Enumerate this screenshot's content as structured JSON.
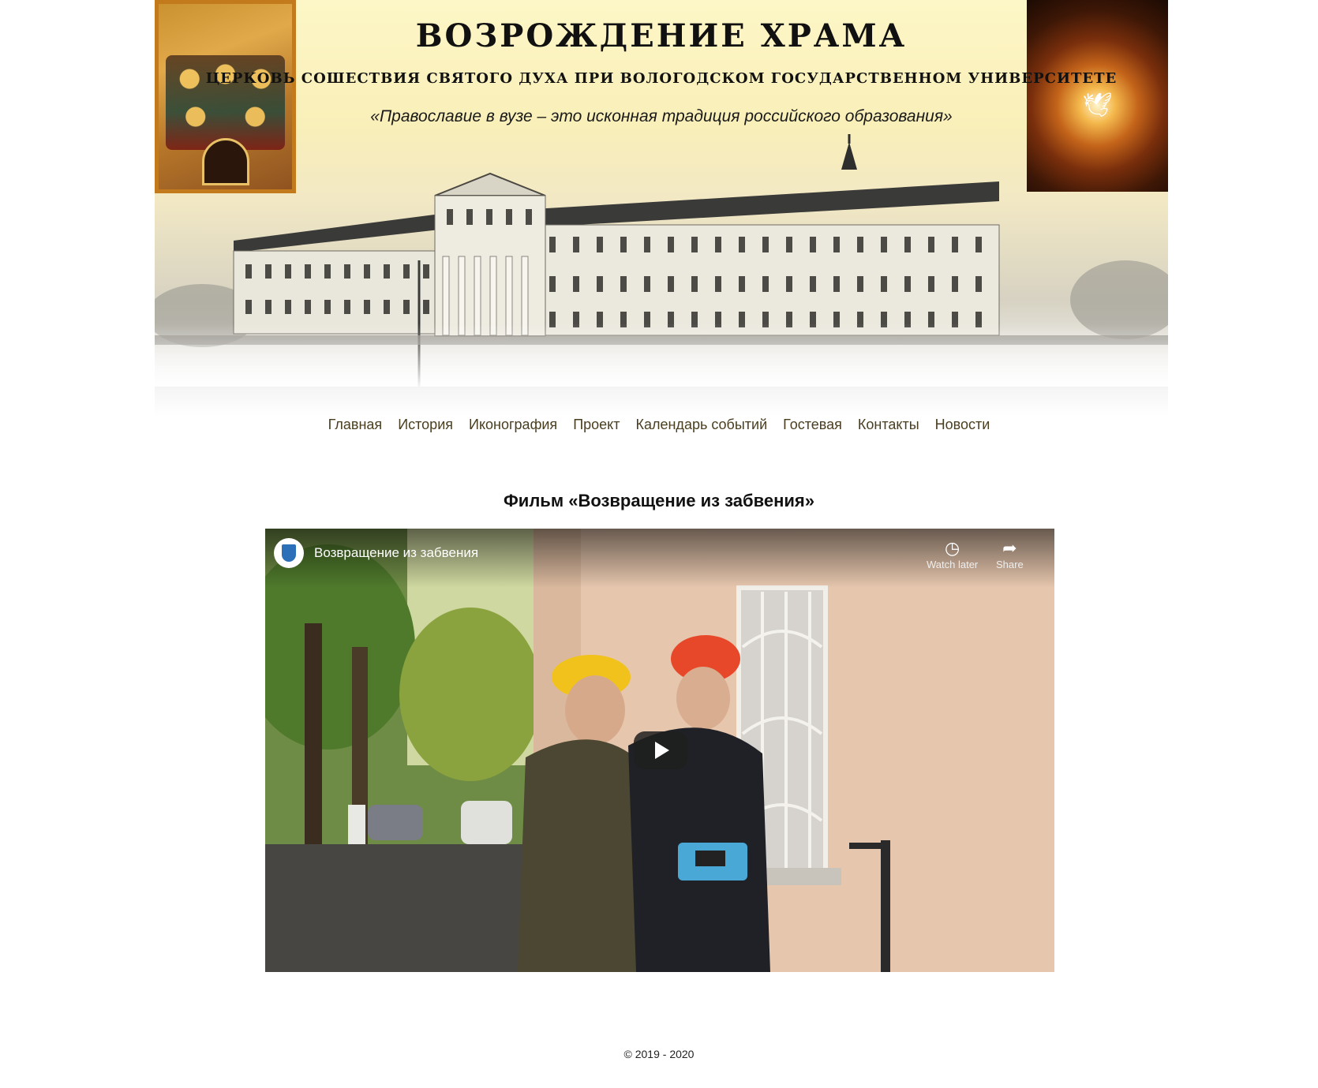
{
  "header": {
    "title": "ВОЗРОЖДЕНИЕ ХРАМА",
    "subtitle": "ЦЕРКОВЬ СОШЕСТВИЯ СВЯТОГО ДУХА ПРИ ВОЛОГОДСКОМ ГОСУДАРСТВЕННОМ УНИВЕРСИТЕТЕ",
    "motto": "«Православие в вузе – это исконная традиция российского образования»"
  },
  "nav": {
    "items": [
      {
        "label": "Главная"
      },
      {
        "label": "История"
      },
      {
        "label": "Иконография"
      },
      {
        "label": "Проект"
      },
      {
        "label": "Календарь событий"
      },
      {
        "label": "Гостевая"
      },
      {
        "label": "Контакты"
      },
      {
        "label": "Новости"
      }
    ]
  },
  "main": {
    "section_title": "Фильм «Возвращение из забвения»",
    "video": {
      "title": "Возвращение из забвения",
      "watch_later": "Watch later",
      "share": "Share"
    }
  },
  "footer": {
    "copyright": "© 2019 - 2020"
  },
  "colors": {
    "nav_link": "#4a3e20",
    "banner_bg": "#fdf6c6"
  }
}
